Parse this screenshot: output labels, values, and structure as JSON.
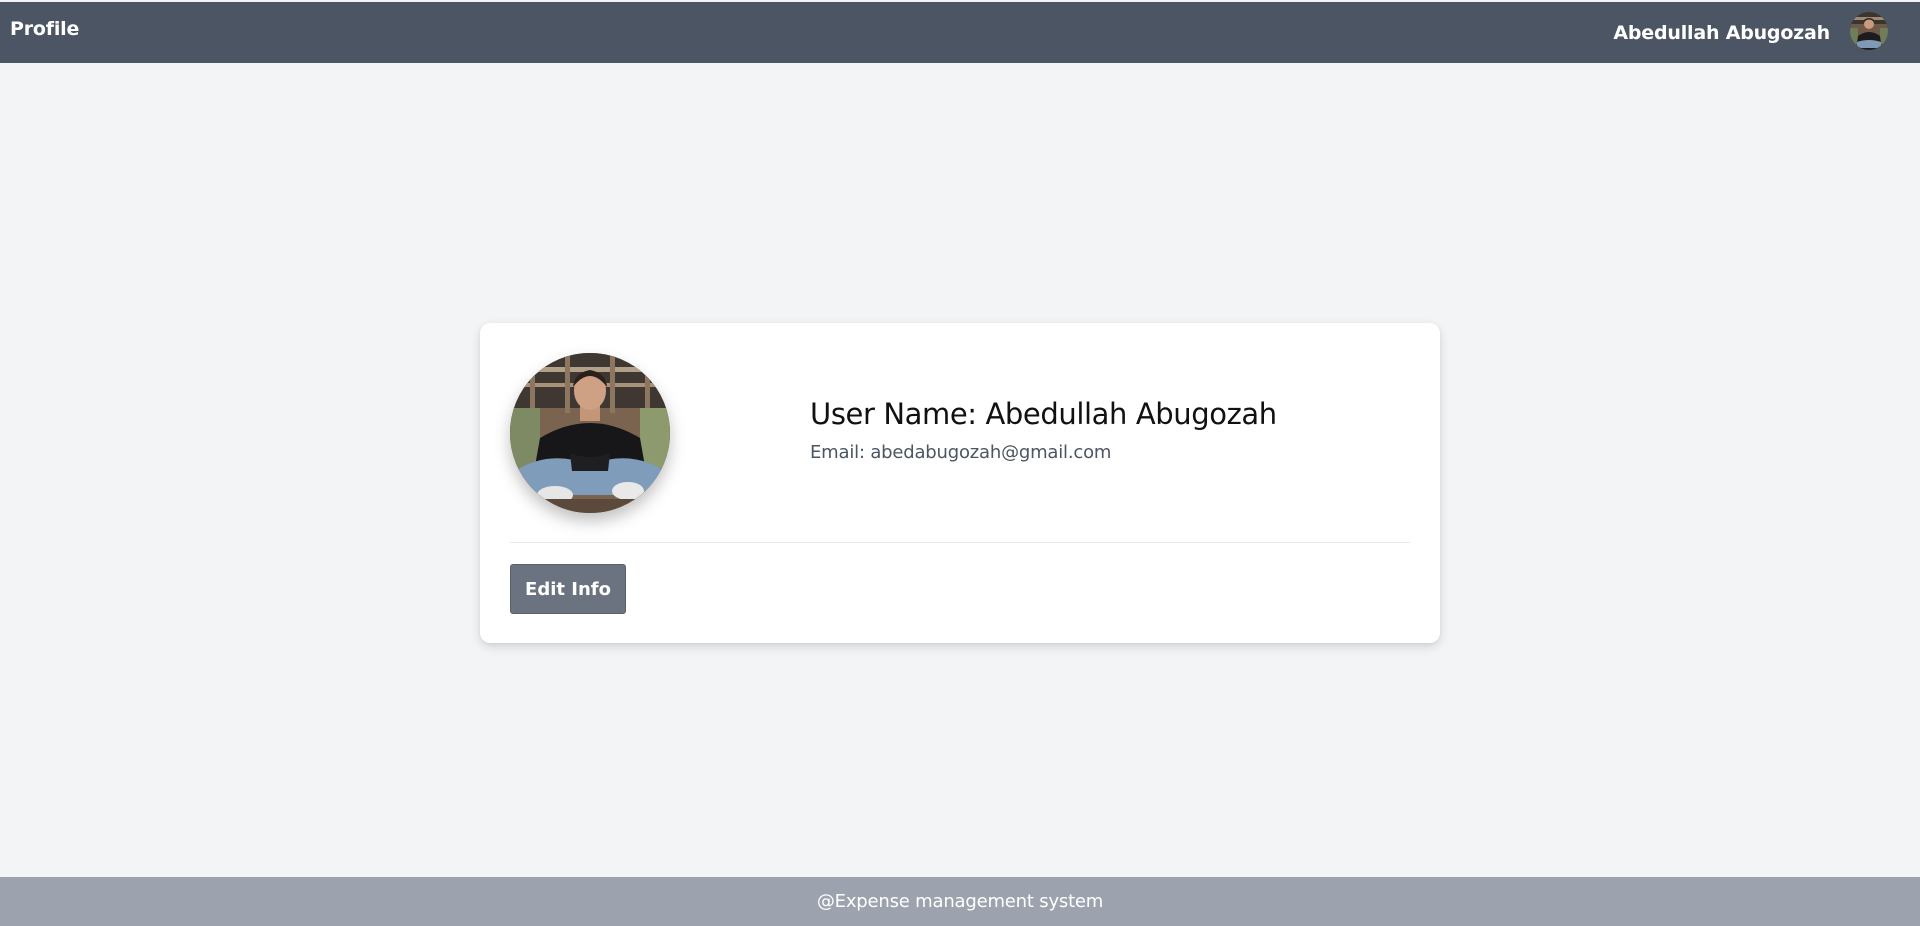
{
  "header": {
    "title": "Profile",
    "user_name": "Abedullah Abugozah",
    "avatar_icon": "user-avatar-photo"
  },
  "profile_card": {
    "avatar_icon": "profile-photo",
    "username": "User Name: Abedullah Abugozah",
    "email": "Email: abedabugozah@gmail.com",
    "edit_button_label": "Edit Info"
  },
  "footer": {
    "text": "@Expense management system"
  },
  "colors": {
    "header_bg": "#4b5563",
    "page_bg": "#f2f4f5",
    "button_bg": "#6b7280",
    "footer_bg": "#9ca3af"
  }
}
